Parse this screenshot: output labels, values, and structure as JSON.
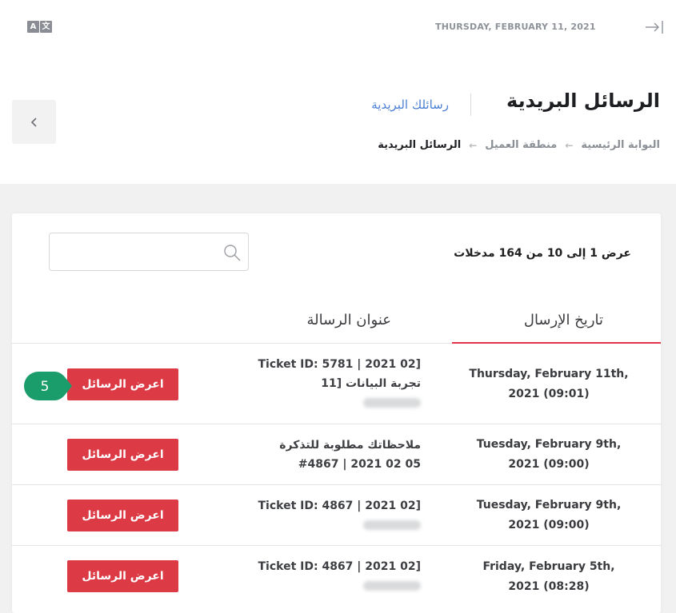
{
  "header": {
    "lang_icon_left": "A",
    "lang_icon_right": "文",
    "date": "THURSDAY, FEBRUARY 11, 2021",
    "icons": [
      "translate-icon",
      "collapse-icon",
      "chevron-left-icon"
    ]
  },
  "page": {
    "title": "الرسائل البريدية",
    "sub_link": "رسائلك البريدية",
    "breadcrumb": [
      "البوابة الرئيسية",
      "منطقة العميل",
      "الرسائل البريدية"
    ]
  },
  "table": {
    "info": "عرض 1 إلى 10 من 164 مدخلات",
    "search_placeholder": "",
    "columns": [
      "تاريخ الإرسال",
      "عنوان الرسالة"
    ],
    "button_label": "اعرض الرسائل",
    "rows": [
      {
        "date1": "Thursday, February 11th,",
        "date2": "2021 (09:01)",
        "subject1": "Ticket ID: 5781 | 2021 02]",
        "subject2": "11] تجربة البيانات"
      },
      {
        "date1": "Tuesday, February 9th,",
        "date2": "2021 (09:00)",
        "subject1": "ملاحظاتك مطلوبة للتذكرة",
        "subject2": "#4867 | 2021 02 05"
      },
      {
        "date1": "Tuesday, February 9th,",
        "date2": "2021 (09:00)",
        "subject1": "Ticket ID: 4867 | 2021 02]",
        "subject2": ""
      },
      {
        "date1": "Friday, February 5th,",
        "date2": "2021 (08:28)",
        "subject1": "Ticket ID: 4867 | 2021 02]",
        "subject2": ""
      }
    ]
  },
  "step_badge": "5",
  "colors": {
    "accent": "#dc3a45",
    "link": "#4a7fd3",
    "badge": "#1a9c6b"
  }
}
